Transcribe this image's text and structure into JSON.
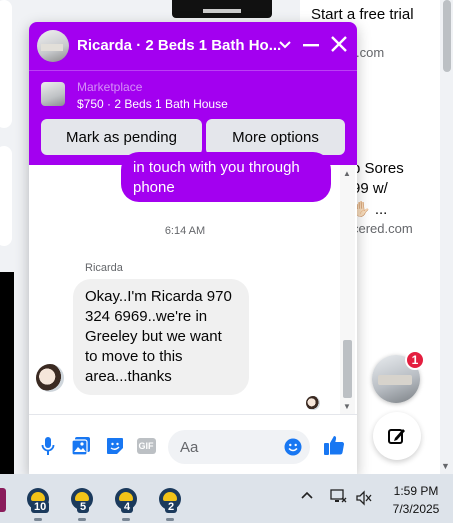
{
  "background": {
    "ad1": {
      "title": "Start a free trial",
      "domain": ".com"
    },
    "ad2": {
      "line1": "p Sores",
      "line2": "99 w/",
      "line3": "✋🏻 ...",
      "domain": "cered.com"
    }
  },
  "floating": {
    "badge_count": "1"
  },
  "chat": {
    "title": "Ricarda · 2 Beds 1 Bath Ho...",
    "marketplace_label": "Marketplace",
    "listing": "$750 · 2 Beds 1 Bath House",
    "buttons": {
      "mark_pending": "Mark as pending",
      "more_options": "More options"
    },
    "outgoing": {
      "line1": "in touch with you through",
      "line2": "phone"
    },
    "timestamp": "6:14 AM",
    "sender_name": "Ricarda",
    "incoming": "Okay..I'm Ricarda 970 324 6969..we're in Greeley but we want to move to this area...thanks",
    "composer": {
      "placeholder": "Aa",
      "gif_label": "GIF"
    }
  },
  "taskbar": {
    "apps": [
      {
        "badge": "10"
      },
      {
        "badge": "5"
      },
      {
        "badge": "4"
      },
      {
        "badge": "2"
      }
    ],
    "clock": {
      "time": "1:59 PM",
      "date": "7/3/2025"
    }
  },
  "colors": {
    "accent": "#a300f0",
    "badge_red": "#e41e3f",
    "like_blue": "#1877f2"
  }
}
